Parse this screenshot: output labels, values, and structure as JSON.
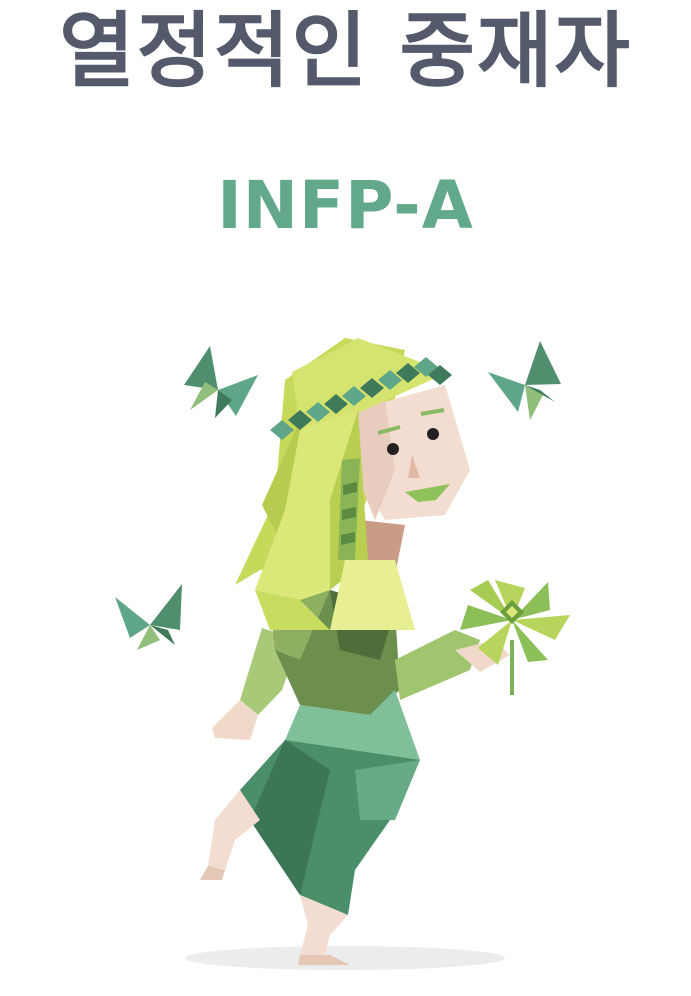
{
  "title": "열정적인 중재자",
  "type_code": "INFP-A",
  "colors": {
    "title": "#545a6c",
    "type_code": "#62a88b",
    "hair_yellow": "#cfe06a",
    "leaf_green": "#5a9a78",
    "skin": "#f3ddd0"
  }
}
